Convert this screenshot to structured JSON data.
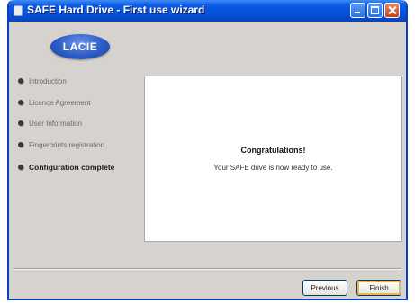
{
  "window": {
    "title": "SAFE Hard Drive - First use wizard"
  },
  "logo": {
    "text": "LACIE"
  },
  "nav": {
    "items": [
      {
        "label": "Introduction",
        "active": false
      },
      {
        "label": "Licence Agreement",
        "active": false
      },
      {
        "label": "User Information",
        "active": false
      },
      {
        "label": "Fingerprints registration",
        "active": false
      },
      {
        "label": "Configuration complete",
        "active": true
      }
    ]
  },
  "content": {
    "heading": "Congratulations!",
    "message": "Your SAFE drive is now ready to use."
  },
  "buttons": {
    "previous": "Previous",
    "finish": "Finish"
  },
  "colors": {
    "titlebar": "#0550d6",
    "frame": "#0a3fc0",
    "logo": "#2c5cc6"
  }
}
